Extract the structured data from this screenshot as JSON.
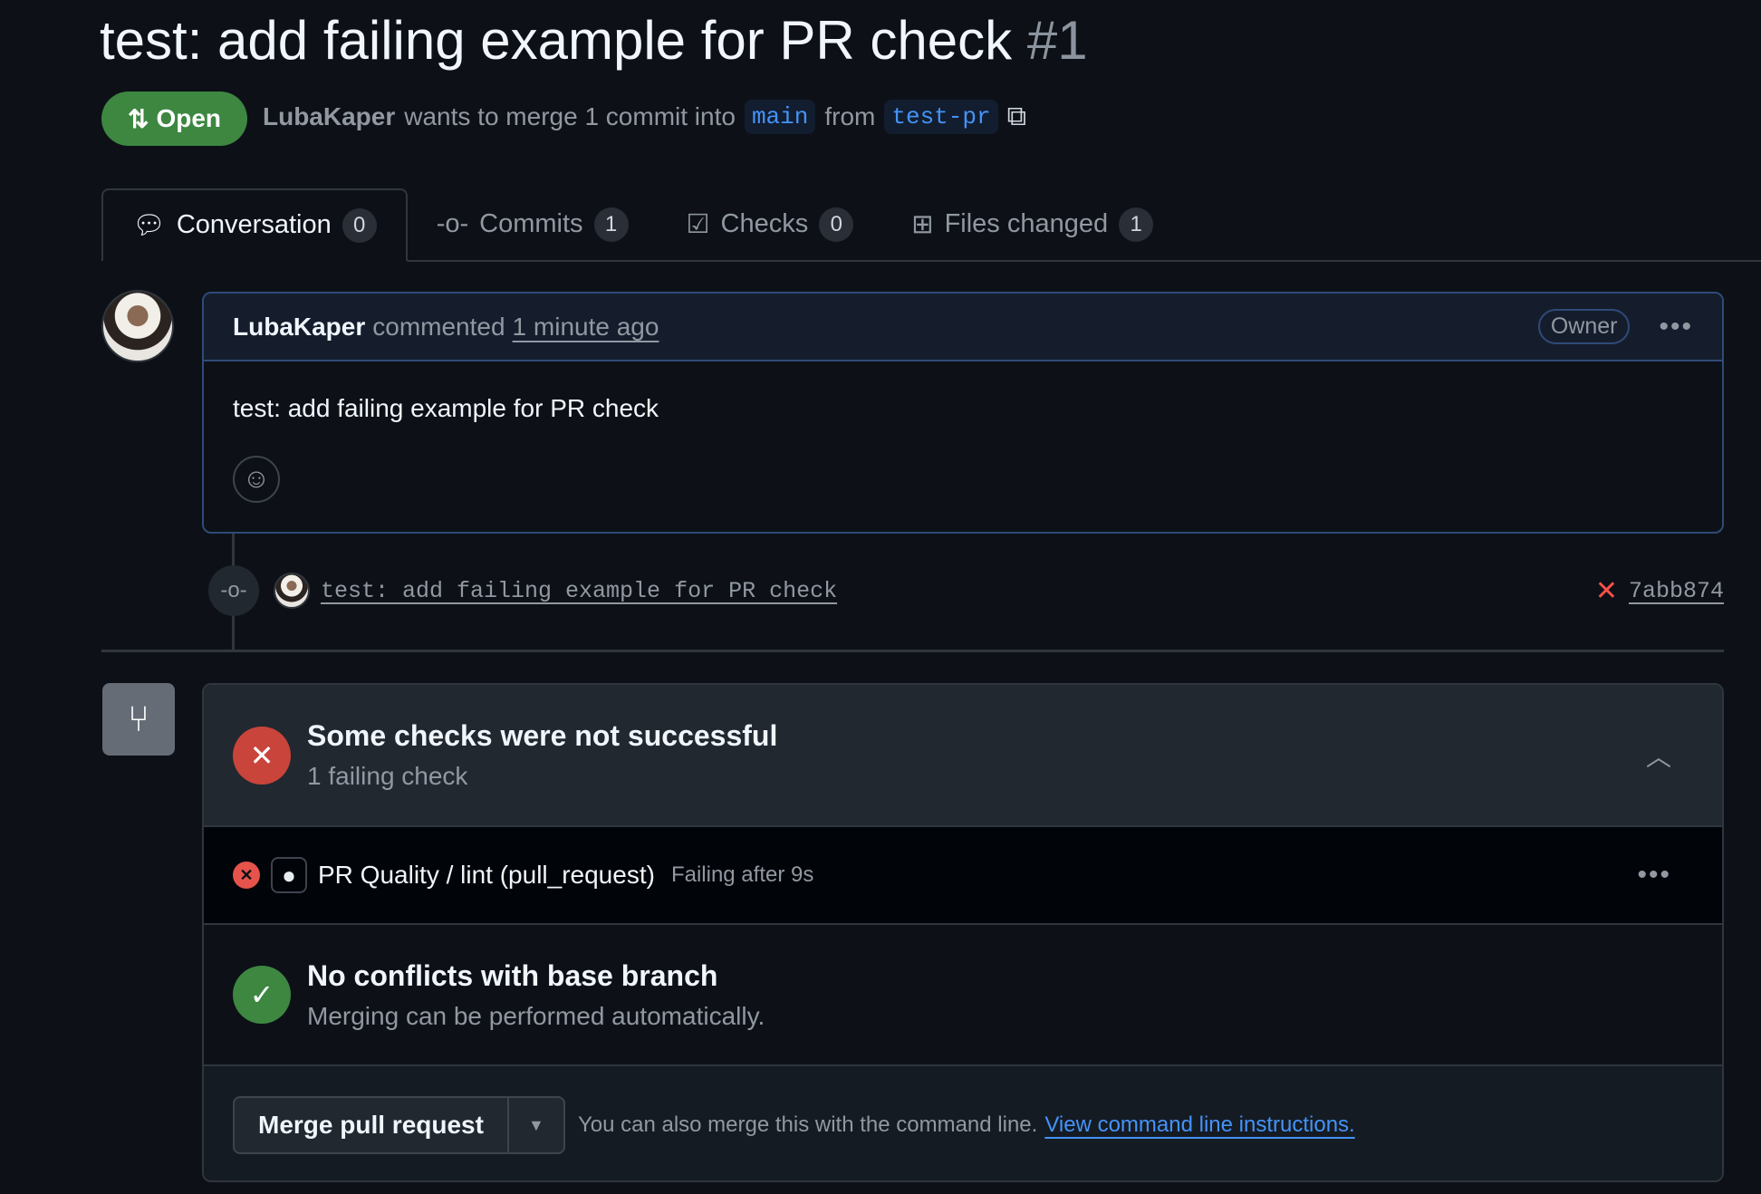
{
  "title": {
    "text": "test: add failing example for PR check",
    "number": "#1"
  },
  "status": {
    "label": "Open",
    "color": "#3d8741"
  },
  "meta": {
    "author": "LubaKaper",
    "text": "wants to merge 1 commit into",
    "base": "main",
    "from": "from",
    "head": "test-pr"
  },
  "tabs": [
    {
      "label": "Conversation",
      "count": "0"
    },
    {
      "label": "Commits",
      "count": "1"
    },
    {
      "label": "Checks",
      "count": "0"
    },
    {
      "label": "Files changed",
      "count": "1"
    }
  ],
  "comment": {
    "author": "LubaKaper",
    "action": "commented",
    "time": "1 minute ago",
    "badge": "Owner",
    "body": "test: add failing example for PR check"
  },
  "commit": {
    "message": "test: add failing example for PR check",
    "sha": "7abb874"
  },
  "checks": {
    "title": "Some checks were not successful",
    "subtitle": "1 failing check",
    "item": {
      "name": "PR Quality / lint (pull_request)",
      "status": "Failing after 9s"
    }
  },
  "conflicts": {
    "title": "No conflicts with base branch",
    "subtitle": "Merging can be performed automatically."
  },
  "merge": {
    "button": "Merge pull request",
    "hint": "You can also merge this with the command line.",
    "link": "View command line instructions."
  }
}
